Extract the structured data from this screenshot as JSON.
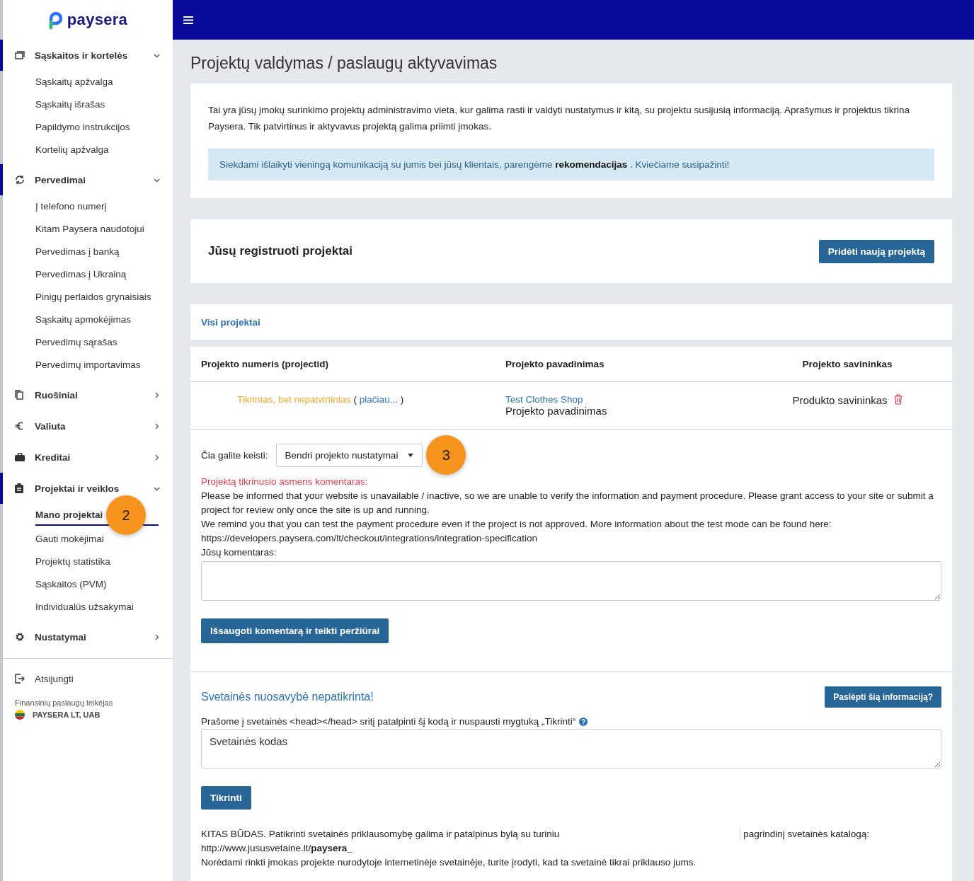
{
  "brand": {
    "name": "paysera"
  },
  "sidebar": {
    "groups": [
      {
        "label": "Sąskaitos ir kortelės",
        "expanded": true,
        "children": [
          {
            "label": "Sąskaitų apžvalga",
            "selected": false
          },
          {
            "label": "Sąskaitų išrašas",
            "selected": false
          },
          {
            "label": "Papildymo instrukcijos",
            "selected": false
          },
          {
            "label": "Kortelių apžvalga",
            "selected": false
          }
        ]
      },
      {
        "label": "Pervedimai",
        "expanded": true,
        "children": [
          {
            "label": "Į telefono numerį",
            "selected": false
          },
          {
            "label": "Kitam Paysera naudotojui",
            "selected": false
          },
          {
            "label": "Pervedimas į banką",
            "selected": false
          },
          {
            "label": "Pervedimas į Ukrainą",
            "selected": false
          },
          {
            "label": "Pinigų perlaidos grynaisiais",
            "selected": false
          },
          {
            "label": "Sąskaitų apmokėjimas",
            "selected": false
          },
          {
            "label": "Pervedimų sąrašas",
            "selected": false
          },
          {
            "label": "Pervedimų importavimas",
            "selected": false
          }
        ]
      },
      {
        "label": "Ruošiniai",
        "expanded": false
      },
      {
        "label": "Valiuta",
        "expanded": false
      },
      {
        "label": "Kreditai",
        "expanded": false
      },
      {
        "label": "Projektai ir veiklos",
        "expanded": true,
        "children": [
          {
            "label": "Mano projektai",
            "selected": true,
            "callout": "2"
          },
          {
            "label": "Gauti mokėjimai",
            "selected": false
          },
          {
            "label": "Projektų statistika",
            "selected": false
          },
          {
            "label": "Sąskaitos (PVM)",
            "selected": false
          },
          {
            "label": "Individualūs užsakymai",
            "selected": false
          }
        ]
      },
      {
        "label": "Nustatymai",
        "expanded": false
      }
    ],
    "logout": "Atsijungti",
    "provider_label": "Finansinių paslaugų teikėjas",
    "provider_name": "PAYSERA LT, UAB"
  },
  "page_title": "Projektų valdymas / paslaugų aktyvavimas",
  "intro": {
    "text": "Tai yra jūsų įmokų surinkimo projektų administravimo vieta, kur galima rasti ir valdyti nustatymus ir kitą, su projektu susijusią informaciją. Aprašymus ir projektus tikrina Paysera. Tik patvirtinus ir aktyvavus projektą galima priimti įmokas.",
    "notice": "Siekdami išlaikyti vieningą komunikaciją su jumis bei jūsų klientais, parengėme **rekomendacijas** . Kviečiame susipažinti!"
  },
  "projects": {
    "title": "Jūsų registruoti projektai",
    "add_button": "Pridėti naują projektą",
    "tabs": [
      {
        "label": "Visi projektai",
        "selected": true
      }
    ],
    "columns": [
      "Projekto numeris (projectid)",
      "Projekto pavadinimas",
      "Projekto savininkas"
    ],
    "rows": [
      {
        "status": "Tikrintas, bet nepatvirtintas",
        "open_paren": "(",
        "more_link": "plačiau...",
        "close_paren": ")",
        "name_link": "Test Clothes Shop",
        "name": "Projekto pavadinimas",
        "owner": "Produkto savininkas"
      }
    ]
  },
  "settings": {
    "label": "Čia galite keisti:",
    "select_value": "Bendri projekto nustatymai",
    "callout": "3",
    "reviewer_label": "Projektą tikrinusio asmens komentaras:",
    "reviewer_comment": [
      "Please be informed that your website is unavailable / inactive, so we are unable to verify the information and payment procedure. Please grant access to your site or submit a project for review only once the site is up and running.",
      "We remind you that you can test the payment procedure even if the project is not approved. More information about the test mode can be found here:",
      "https://developers.paysera.com/lt/checkout/integrations/integration-specification"
    ],
    "comment_label": "Jūsų komentaras:",
    "submit_button": "Išsaugoti komentarą ir teikti peržiūrai"
  },
  "ownership": {
    "title": "Svetainės nuosavybė nepatikrinta!",
    "hide_button": "Paslėpti šią informaciją?",
    "instruction": "Prašome į svetainės <head></head> sritį patalpinti šį kodą ir nuspausti mygtuką „Tikrinti“",
    "code_value": "Svetainės kodas",
    "check_button": "Tikrinti",
    "alt_text_start": "KITAS BŪDAS. Patikrinti svetainės priklausomybę galima ir patalpinus bylą su turiniu",
    "alt_text_end": "pagrindinį svetainės katalogą:",
    "alt_url": "http://www.jususvetaine.lt/**paysera_**",
    "alt_note": "Norėdami rinkti įmokas projekte nurodytoje internetinėje svetainėje, turite įrodyti, kad ta svetainė tikrai priklauso jums."
  }
}
